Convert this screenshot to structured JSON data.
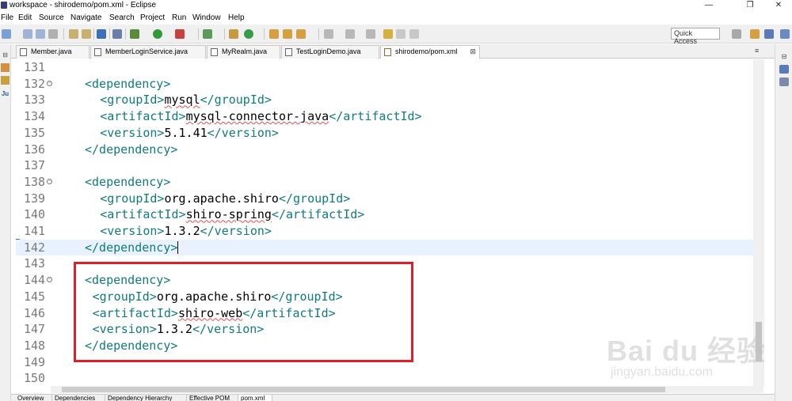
{
  "window": {
    "title": "workspace - shirodemo/pom.xml - Eclipse",
    "min": "—",
    "max": "❐",
    "close": "✕"
  },
  "menu": [
    "File",
    "Edit",
    "Source",
    "Navigate",
    "Search",
    "Project",
    "Run",
    "Window",
    "Help"
  ],
  "toolbar": {
    "quick_access": "Quick Access",
    "icons": [
      "new-icon",
      "save-icon",
      "save-all-icon",
      "print-icon",
      "skip-breakpoints-icon",
      "external-tools-icon",
      "debug-icon",
      "run-icon",
      "coverage-icon",
      "new-class-icon",
      "open-type-icon",
      "search-icon",
      "open-perspective-icon",
      "annotation-icon",
      "back-icon",
      "forward-icon"
    ]
  },
  "tabs": [
    {
      "label": "Member.java",
      "active": false
    },
    {
      "label": "MemberLoginService.java",
      "active": false
    },
    {
      "label": "MyRealm.java",
      "active": false
    },
    {
      "label": "TestLoginDemo.java",
      "active": false
    },
    {
      "label": "shirodemo/pom.xml",
      "active": true
    }
  ],
  "tab_close": "⊠",
  "tab_overflow": "≡",
  "editor": {
    "current_line": 142,
    "lines": [
      {
        "num": "131",
        "fold": false,
        "code": ""
      },
      {
        "num": "132",
        "fold": true,
        "code": "<dependency>",
        "indent": 2
      },
      {
        "num": "133",
        "fold": false,
        "open": "<groupId>",
        "value": "mysql",
        "close": "</groupId>",
        "indent": 4,
        "squig": true
      },
      {
        "num": "134",
        "fold": false,
        "open": "<artifactId>",
        "value": "mysql-connector-java",
        "close": "</artifactId>",
        "indent": 4,
        "squig": true
      },
      {
        "num": "135",
        "fold": false,
        "open": "<version>",
        "value": "5.1.41",
        "close": "</version>",
        "indent": 4
      },
      {
        "num": "136",
        "fold": false,
        "code": "</dependency>",
        "indent": 2
      },
      {
        "num": "137",
        "fold": false,
        "code": ""
      },
      {
        "num": "138",
        "fold": true,
        "code": "<dependency>",
        "indent": 2
      },
      {
        "num": "139",
        "fold": false,
        "open": "<groupId>",
        "value": "org.apache.shiro",
        "close": "</groupId>",
        "indent": 4
      },
      {
        "num": "140",
        "fold": false,
        "open": "<artifactId>",
        "value": "shiro-spring",
        "close": "</artifactId>",
        "indent": 4,
        "squig": true
      },
      {
        "num": "141",
        "fold": false,
        "open": "<version>",
        "value": "1.3.2",
        "close": "</version>",
        "indent": 4
      },
      {
        "num": "142",
        "fold": false,
        "code": "</dependency>",
        "indent": 2,
        "caret": true
      },
      {
        "num": "143",
        "fold": false,
        "code": ""
      },
      {
        "num": "144",
        "fold": true,
        "code": "<dependency>",
        "indent": 2
      },
      {
        "num": "145",
        "fold": false,
        "open": "<groupId>",
        "value": "org.apache.shiro",
        "close": "</groupId>",
        "indent": 3
      },
      {
        "num": "146",
        "fold": false,
        "open": "<artifactId>",
        "value": "shiro-web",
        "close": "</artifactId>",
        "indent": 3,
        "squig": true
      },
      {
        "num": "147",
        "fold": false,
        "open": "<version>",
        "value": "1.3.2",
        "close": "</version>",
        "indent": 3
      },
      {
        "num": "148",
        "fold": false,
        "code": "</dependency>",
        "indent": 2
      },
      {
        "num": "149",
        "fold": false,
        "code": ""
      },
      {
        "num": "150",
        "fold": false,
        "code": ""
      }
    ]
  },
  "bottom_tabs": [
    "Overview",
    "Dependencies",
    "Dependency Hierarchy",
    "Effective POM",
    "pom.xml"
  ],
  "watermark": {
    "logo": "Bai du 经验",
    "url": "jingyan.baidu.com"
  },
  "colors": {
    "tag": "#117b7d",
    "highlight_box": "#e01e2a",
    "current_line": "#e8f2fe"
  }
}
